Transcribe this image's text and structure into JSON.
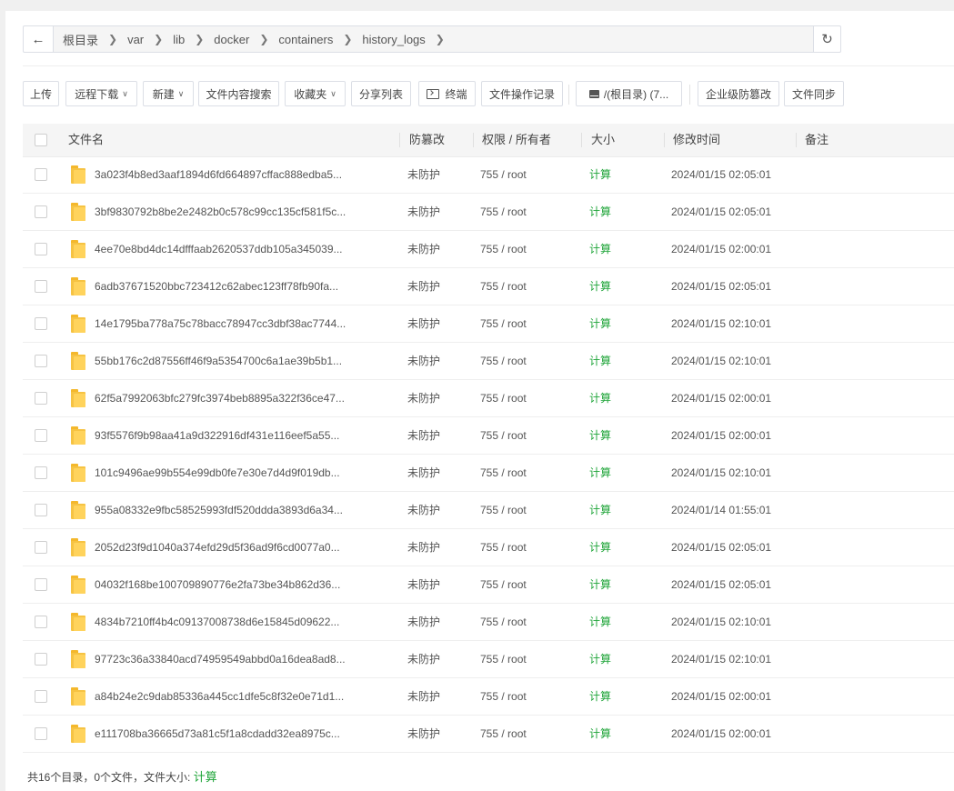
{
  "breadcrumb": {
    "back_icon": "←",
    "segments": [
      "根目录",
      "var",
      "lib",
      "docker",
      "containers",
      "history_logs"
    ],
    "refresh_icon": "↻"
  },
  "toolbar": {
    "upload": "上传",
    "remote_download": "远程下载",
    "new": "新建",
    "content_search": "文件内容搜索",
    "favorites": "收藏夹",
    "share_list": "分享列表",
    "terminal": "终端",
    "op_log": "文件操作记录",
    "disk": "/(根目录) (7...",
    "anti_tamper": "企业级防篡改",
    "file_sync": "文件同步"
  },
  "table": {
    "headers": {
      "name": "文件名",
      "protection": "防篡改",
      "perm": "权限 / 所有者",
      "size": "大小",
      "mtime": "修改时间",
      "note": "备注"
    },
    "rows": [
      {
        "name": "3a023f4b8ed3aaf1894d6fd664897cffac888edba5...",
        "protection": "未防护",
        "perm": "755 / root",
        "size": "计算",
        "mtime": "2024/01/15 02:05:01"
      },
      {
        "name": "3bf9830792b8be2e2482b0c578c99cc135cf581f5c...",
        "protection": "未防护",
        "perm": "755 / root",
        "size": "计算",
        "mtime": "2024/01/15 02:05:01"
      },
      {
        "name": "4ee70e8bd4dc14dfffaab2620537ddb105a345039...",
        "protection": "未防护",
        "perm": "755 / root",
        "size": "计算",
        "mtime": "2024/01/15 02:00:01"
      },
      {
        "name": "6adb37671520bbc723412c62abec123ff78fb90fa...",
        "protection": "未防护",
        "perm": "755 / root",
        "size": "计算",
        "mtime": "2024/01/15 02:05:01"
      },
      {
        "name": "14e1795ba778a75c78bacc78947cc3dbf38ac7744...",
        "protection": "未防护",
        "perm": "755 / root",
        "size": "计算",
        "mtime": "2024/01/15 02:10:01"
      },
      {
        "name": "55bb176c2d87556ff46f9a5354700c6a1ae39b5b1...",
        "protection": "未防护",
        "perm": "755 / root",
        "size": "计算",
        "mtime": "2024/01/15 02:10:01"
      },
      {
        "name": "62f5a7992063bfc279fc3974beb8895a322f36ce47...",
        "protection": "未防护",
        "perm": "755 / root",
        "size": "计算",
        "mtime": "2024/01/15 02:00:01"
      },
      {
        "name": "93f5576f9b98aa41a9d322916df431e116eef5a55...",
        "protection": "未防护",
        "perm": "755 / root",
        "size": "计算",
        "mtime": "2024/01/15 02:00:01"
      },
      {
        "name": "101c9496ae99b554e99db0fe7e30e7d4d9f019db...",
        "protection": "未防护",
        "perm": "755 / root",
        "size": "计算",
        "mtime": "2024/01/15 02:10:01"
      },
      {
        "name": "955a08332e9fbc58525993fdf520ddda3893d6a34...",
        "protection": "未防护",
        "perm": "755 / root",
        "size": "计算",
        "mtime": "2024/01/14 01:55:01"
      },
      {
        "name": "2052d23f9d1040a374efd29d5f36ad9f6cd0077a0...",
        "protection": "未防护",
        "perm": "755 / root",
        "size": "计算",
        "mtime": "2024/01/15 02:05:01"
      },
      {
        "name": "04032f168be100709890776e2fa73be34b862d36...",
        "protection": "未防护",
        "perm": "755 / root",
        "size": "计算",
        "mtime": "2024/01/15 02:05:01"
      },
      {
        "name": "4834b7210ff4b4c09137008738d6e15845d09622...",
        "protection": "未防护",
        "perm": "755 / root",
        "size": "计算",
        "mtime": "2024/01/15 02:10:01"
      },
      {
        "name": "97723c36a33840acd74959549abbd0a16dea8ad8...",
        "protection": "未防护",
        "perm": "755 / root",
        "size": "计算",
        "mtime": "2024/01/15 02:10:01"
      },
      {
        "name": "a84b24e2c9dab85336a445cc1dfe5c8f32e0e71d1...",
        "protection": "未防护",
        "perm": "755 / root",
        "size": "计算",
        "mtime": "2024/01/15 02:00:01"
      },
      {
        "name": "e111708ba36665d73a81c5f1a8cdadd32ea8975c...",
        "protection": "未防护",
        "perm": "755 / root",
        "size": "计算",
        "mtime": "2024/01/15 02:00:01"
      }
    ]
  },
  "footer": {
    "summary": "共16个目录，0个文件，文件大小: ",
    "calc": "计算"
  },
  "colors": {
    "accent_green": "#20a53a",
    "folder_yellow": "#f6c343"
  }
}
